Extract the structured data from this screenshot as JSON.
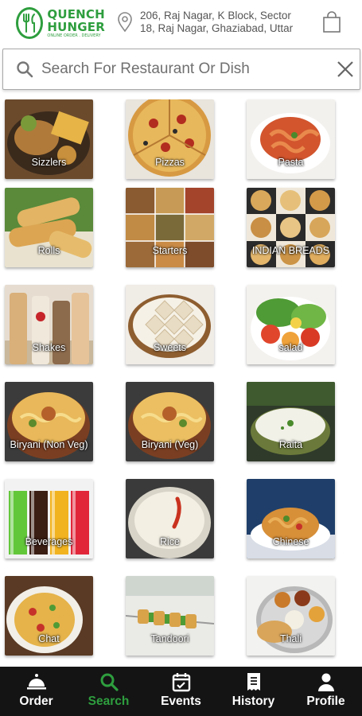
{
  "header": {
    "logo_line1": "QUENCH",
    "logo_line2": "HUNGER",
    "logo_tagline": "ONLINE ORDER . DELIVERY",
    "address_line1": "206, Raj Nagar, K Block, Sector",
    "address_line2": "18, Raj Nagar, Ghaziabad, Uttar"
  },
  "search": {
    "placeholder": "Search For Restaurant Or Dish"
  },
  "categories": [
    {
      "label": "Sizzlers"
    },
    {
      "label": "Pizzas"
    },
    {
      "label": "Pasta"
    },
    {
      "label": "Rolls"
    },
    {
      "label": "Starters"
    },
    {
      "label": "INDIAN BREADS"
    },
    {
      "label": "Shakes"
    },
    {
      "label": "Sweets"
    },
    {
      "label": "salad"
    },
    {
      "label": "Biryani (Non Veg)"
    },
    {
      "label": "Biryani  (Veg)"
    },
    {
      "label": "Raita"
    },
    {
      "label": "Beverages"
    },
    {
      "label": "Rice"
    },
    {
      "label": "Chinese"
    },
    {
      "label": "Chat"
    },
    {
      "label": "Tandoori"
    },
    {
      "label": "Thali"
    }
  ],
  "nav": {
    "items": [
      {
        "label": "Order",
        "icon": "cloche-icon"
      },
      {
        "label": "Search",
        "icon": "search-icon"
      },
      {
        "label": "Events",
        "icon": "calendar-icon"
      },
      {
        "label": "History",
        "icon": "receipt-icon"
      },
      {
        "label": "Profile",
        "icon": "person-icon"
      }
    ],
    "active_index": 1
  },
  "colors": {
    "brand_green": "#2e9e3e",
    "nav_background": "#141414"
  }
}
